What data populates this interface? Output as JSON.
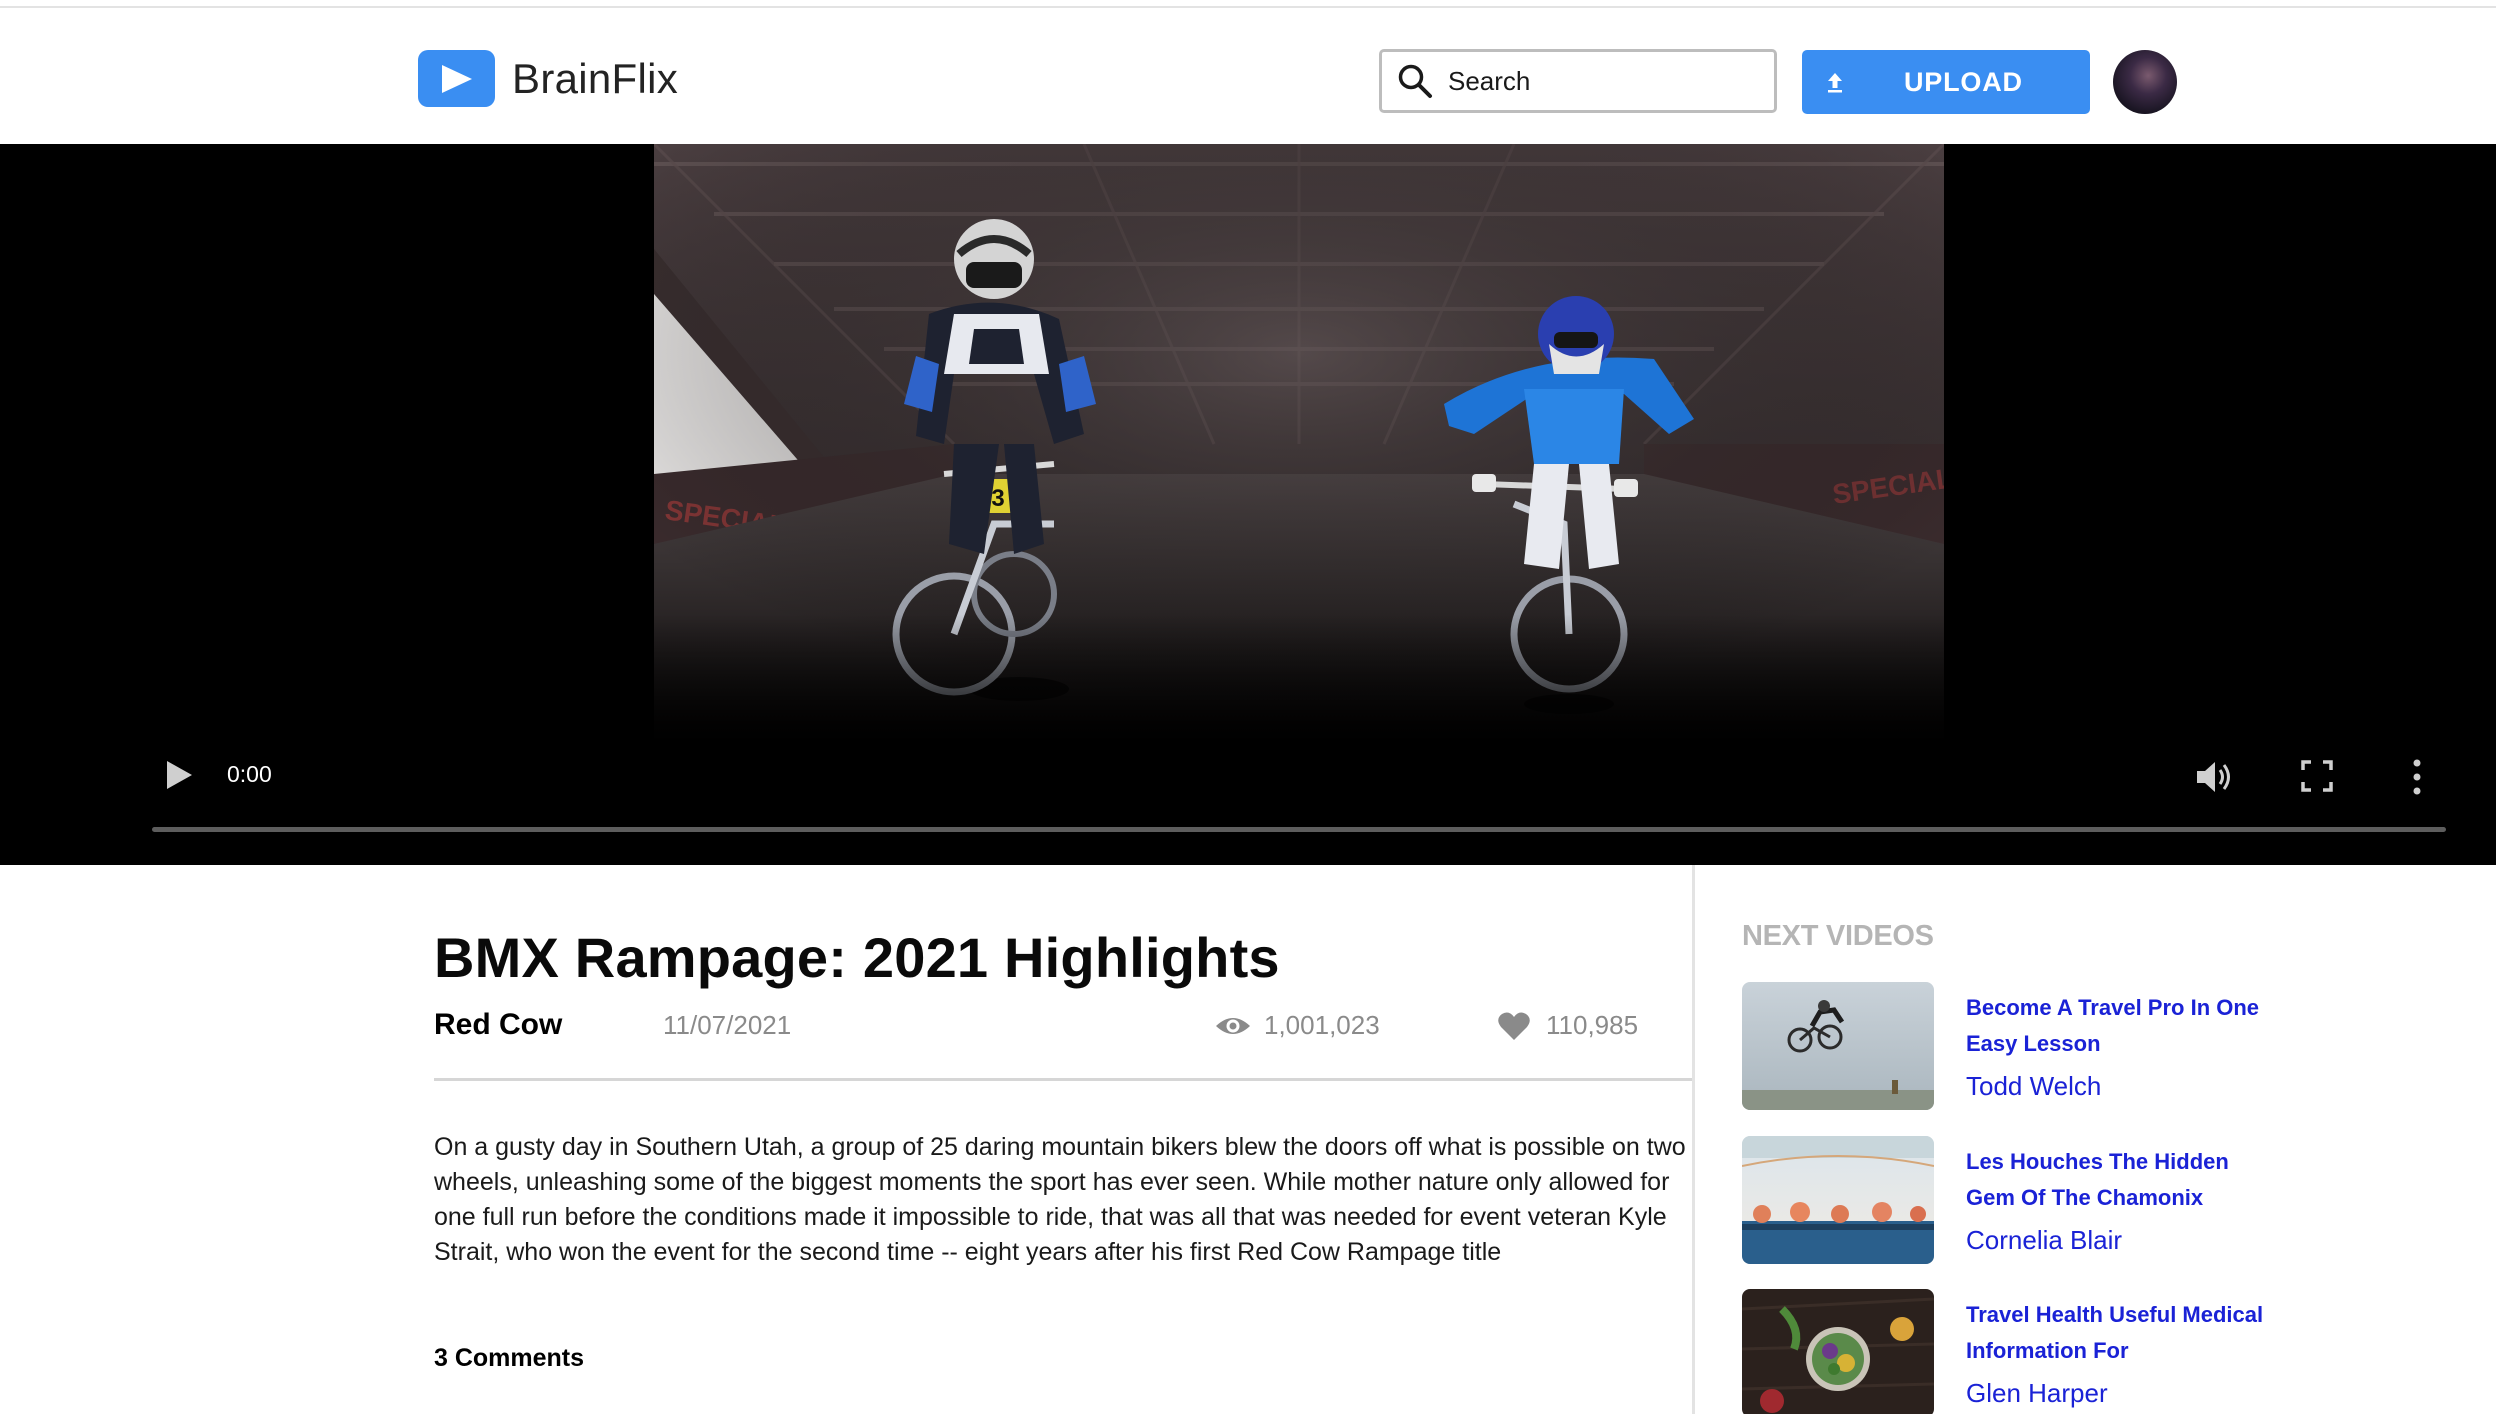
{
  "app": {
    "name": "BrainFlix",
    "brand_color": "#3a8ef2"
  },
  "header": {
    "search_placeholder": "Search",
    "upload_label": "UPLOAD"
  },
  "player": {
    "current_time": "0:00",
    "progress_percent": 0
  },
  "video": {
    "title": "BMX Rampage: 2021 Highlights",
    "channel": "Red Cow",
    "date": "11/07/2021",
    "views": "1,001,023",
    "likes": "110,985",
    "description": "On a gusty day in Southern Utah, a group of 25 daring mountain bikers blew the doors off what is possible on two wheels, unleashing some of the biggest moments the sport has ever seen. While mother nature only allowed for one full run before the conditions made it impossible to ride, that was all that was needed for event veteran Kyle Strait, who won the event for the second time -- eight years after his first Red Cow Rampage title",
    "comments_label": "3 Comments"
  },
  "sidebar": {
    "heading": "NEXT VIDEOS",
    "link_color": "#1a22d6",
    "items": [
      {
        "title": "Become A Travel Pro In One Easy Lesson",
        "author": "Todd Welch"
      },
      {
        "title": "Les Houches The Hidden Gem Of The Chamonix",
        "author": "Cornelia Blair"
      },
      {
        "title": "Travel Health Useful Medical Information For",
        "author": "Glen Harper"
      }
    ]
  }
}
